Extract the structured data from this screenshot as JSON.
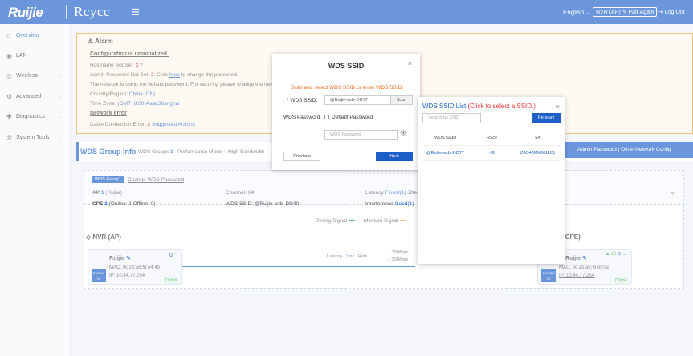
{
  "header": {
    "logo": "Ruijie",
    "brand": "Rcycc",
    "menu_icon": "☰",
    "language": "English",
    "language_caret": "⌄",
    "device_mode": "NVR (AP)",
    "pair_again": "Pair Again",
    "pair_icon": "✎",
    "logout": "Log Out",
    "logout_icon": "⇥"
  },
  "sidebar": {
    "items": [
      {
        "icon": "⌂",
        "label": "Overview"
      },
      {
        "icon": "◉",
        "label": "LAN"
      },
      {
        "icon": "◎",
        "label": "Wireless",
        "chevron": "⌄"
      },
      {
        "icon": "⚙",
        "label": "Advanced",
        "chevron": "⌄"
      },
      {
        "icon": "✚",
        "label": "Diagnostics",
        "chevron": "⌄"
      },
      {
        "icon": "⚒",
        "label": "System Tools",
        "chevron": "⌄"
      }
    ]
  },
  "alarm": {
    "title": "Alarm",
    "chevron": "⌄",
    "heading": "Configuration is uninitialized.",
    "hostname": "Hostname Not Set:",
    "hostname_count": "2",
    "admin_prefix": "Admin Password Not Set:",
    "admin_count": "2",
    "admin_mid": ". Click",
    "admin_link": "here",
    "admin_suffix": "to change the password.",
    "default_pw": "The network is using the default password. For security, please change the network password.",
    "country_label": "Country/Region:",
    "country_value": "China (CN)",
    "tz_label": "Time Zone:",
    "tz_value": "(GMT+8:00)Asia/Shanghai",
    "net_error": "Network error",
    "cable_label": "Cable Connection Error:",
    "cable_count": "2",
    "cable_link": "Suggested Actions",
    "help": "?"
  },
  "wds": {
    "title": "WDS Group Info",
    "groups_label": "WDS Groups",
    "groups_count": "1",
    "perf_label": "Performance Mode",
    "bandwidth": "High Bandwidth",
    "admin_pw": "Admin Password",
    "other": "Other Network Config",
    "sep": "|",
    "group_name": "WDS Group1",
    "change_pw": "Change WDS Password",
    "ap_label": "AP",
    "ap_count": "1",
    "ap_brand": "(Ruijie)",
    "cpe_label": "CPE",
    "cpe_count": "1",
    "cpe_online": "(Online: 1",
    "cpe_offline": "Offline: 0)",
    "channel": "Channel: 64",
    "wds_ssid": "WDS SSID: @Ruijie-wds-DD40",
    "latency": "Latency",
    "latency_val": "Fluent(1)",
    "jitter": "Jitter",
    "interference": "Interference",
    "interference_val": "Good(1)",
    "strong": "Strong Signal",
    "medium": "Medium Signal",
    "nvr_title": "NVR (AP)",
    "cpe_title": "(CPE)",
    "card1_name": "Ruijie",
    "card1_mac": "MAC: 9c:2b:a6:fd:e4:4b",
    "card1_ip": "IP: 10.44.77.254",
    "card1_status": "Online",
    "card2_name": "Ruijie",
    "card2_mac": "MAC: 9c:2b:a6:f6:e0:ba",
    "card2_ip": "IP: 10.44.77.254",
    "card2_status": "Online",
    "tag1": "EST316",
    "tag1b": "V2",
    "tag2": "EST316",
    "tag2b": "V2",
    "link_latency": "Latency",
    "link_latency_val": "1ms",
    "link_rate": "Rate",
    "rate_up": "350Mbps",
    "rate_down": "350Mbps",
    "signal_10": "10",
    "edit_icon": "✎",
    "gear_icon": "⚙",
    "caret": "⌄"
  },
  "modal_ssid": {
    "title": "WDS SSID",
    "close": "×",
    "hint": "Scan and select WDS SSID or enter WDS SSID.",
    "ssid_label": "* WDS SSID:",
    "ssid_value": "@Ruijie-wds-DD77",
    "scan": "Scan",
    "pw_label": "WDS Password",
    "default_pw": "Default Password",
    "pw_placeholder": "WDS Password",
    "eye": "👁",
    "prev": "Previous",
    "next": "Next"
  },
  "modal_list": {
    "title": "WDS SSID List",
    "title_hint": "(Click to select a SSID.)",
    "close": "×",
    "search_placeholder": "Search by SSID",
    "rescan": "Re-scan",
    "columns": [
      "WDS SSID",
      "RSSI",
      "SN"
    ],
    "rows": [
      {
        "ssid": "@Ruijie-wds-DD77",
        "rssi": "-30",
        "sn": "ZAS40MK001165"
      }
    ]
  },
  "colors": {
    "primary": "#1c5fc9",
    "alarm_border": "#e7a23f",
    "error": "#e33333",
    "hint": "#f06a1a"
  }
}
